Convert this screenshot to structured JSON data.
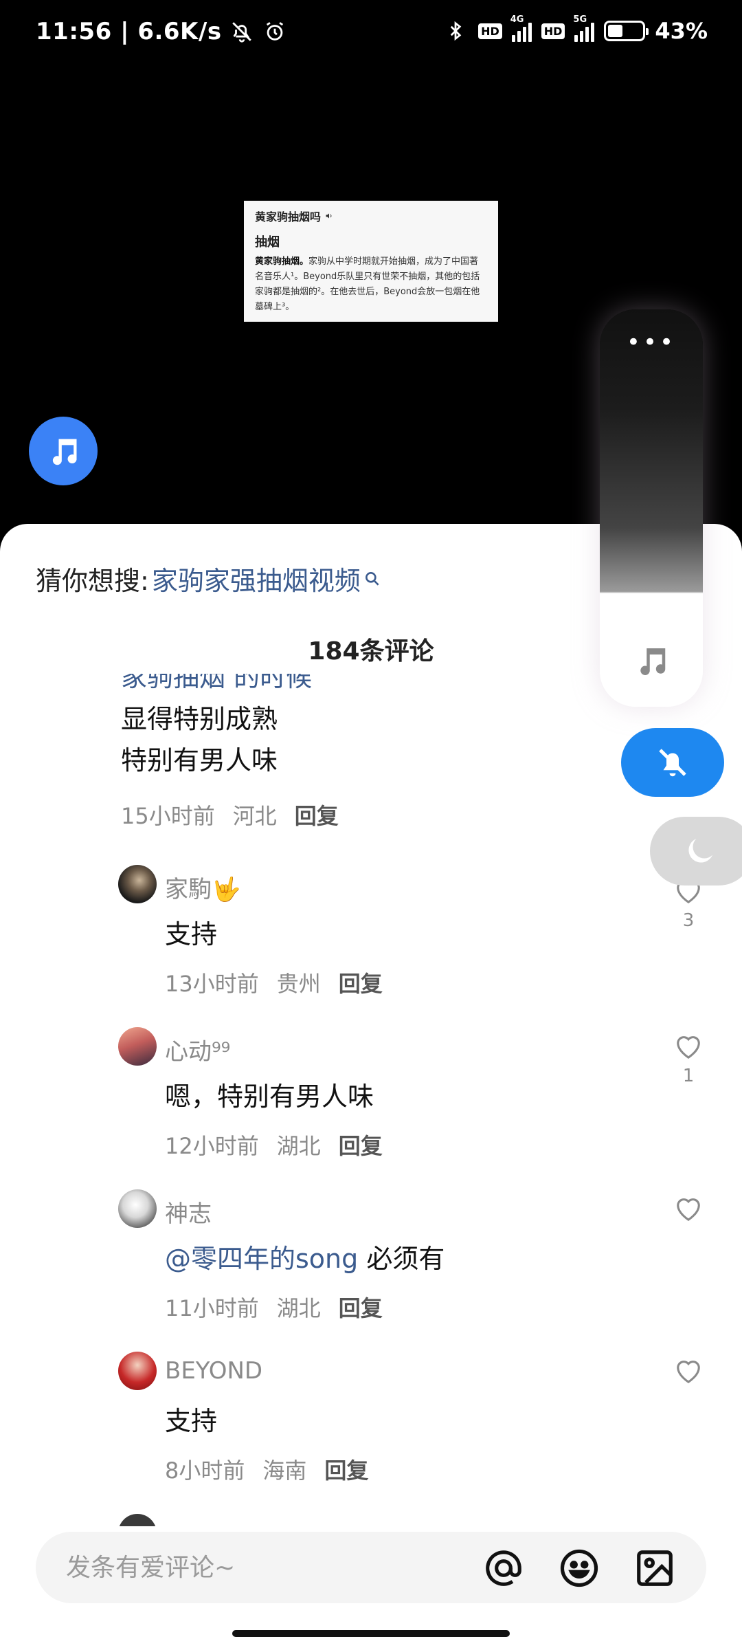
{
  "status_bar": {
    "time_speed": "11:56 | 6.6K/s",
    "battery": "43%",
    "battery_level": 0.43,
    "network1": "4G",
    "network2": "5G",
    "hd": "HD"
  },
  "video_card": {
    "title": "黄家驹抽烟吗",
    "subtitle": "抽烟",
    "body_bold": "黄家驹抽烟。",
    "body_rest": "家驹从中学时期就开始抽烟，成为了中国著名音乐人¹。Beyond乐队里只有世荣不抽烟，其他的包括家驹都是抽烟的²。在他去世后，Beyond会放一包烟在他墓碑上³。"
  },
  "sheet": {
    "suggest_prefix": "猜你想搜:",
    "suggest_query": "家驹家强抽烟视频",
    "comment_count": "184条评论",
    "partial_comment": {
      "cut_text": "家驹抽烟 的时候",
      "lines": [
        "显得特别成熟",
        "特别有男人味"
      ],
      "time": "15小时前",
      "location": "河北",
      "reply": "回复"
    },
    "replies": [
      {
        "name": "家駒🤟",
        "text": "支持",
        "time": "13小时前",
        "location": "贵州",
        "reply": "回复",
        "likes": "3"
      },
      {
        "name": "心动⁹⁹",
        "text": "嗯，特别有男人味",
        "time": "12小时前",
        "location": "湖北",
        "reply": "回复",
        "likes": "1"
      },
      {
        "name": "神志",
        "mention": "@零四年的song",
        "text": " 必须有",
        "time": "11小时前",
        "location": "湖北",
        "reply": "回复",
        "likes": ""
      },
      {
        "name": "BEYOND",
        "text": "支持",
        "time": "8小时前",
        "location": "海南",
        "reply": "回复",
        "likes": ""
      }
    ]
  },
  "input": {
    "placeholder": "发条有爱评论~"
  },
  "side_panel": {
    "dots": "•••"
  },
  "colors": {
    "accent_blue": "#1e88f0",
    "link_blue": "#3b5b8e",
    "music_bubble": "#3b82f6"
  },
  "icons": [
    "bell-off-icon",
    "alarm-icon",
    "bluetooth-icon",
    "signal-icon",
    "battery-icon",
    "music-note-icon",
    "search-icon",
    "heart-icon",
    "at-icon",
    "emoji-icon",
    "image-icon",
    "moon-icon",
    "more-dots-icon"
  ]
}
